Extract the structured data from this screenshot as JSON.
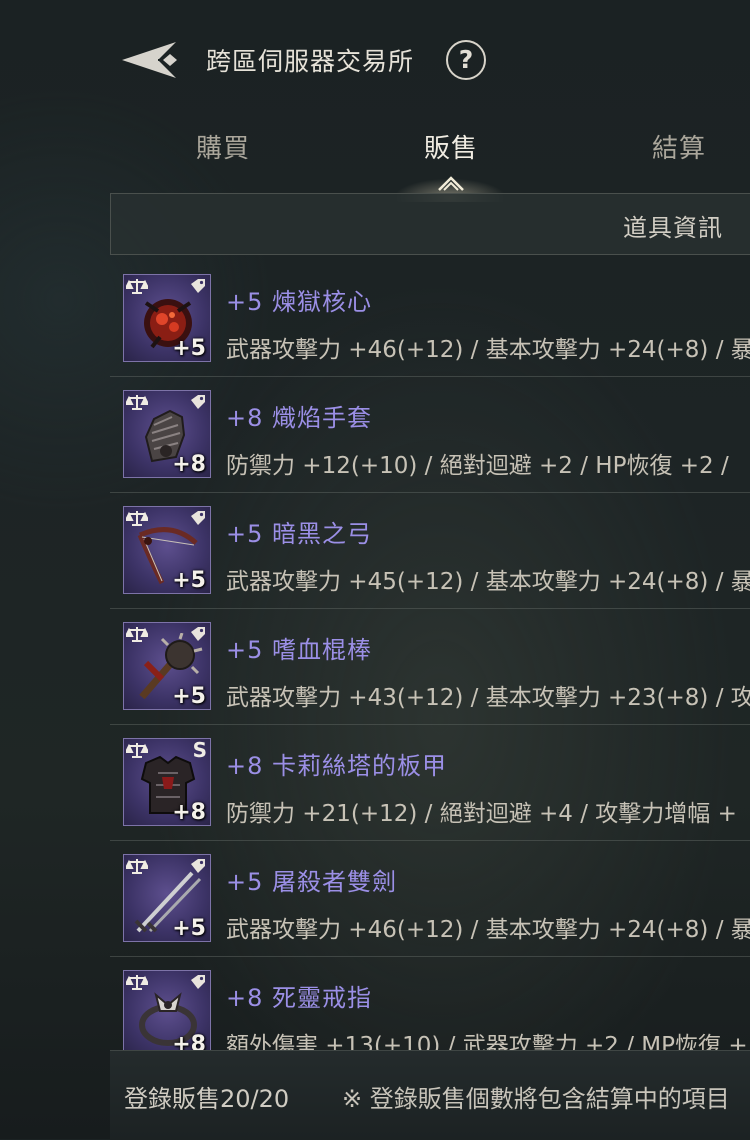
{
  "header": {
    "title": "跨區伺服器交易所",
    "back_icon": "back-arrow-icon",
    "help_label": "?"
  },
  "tabs": [
    {
      "label": "購買",
      "active": false
    },
    {
      "label": "販售",
      "active": true
    },
    {
      "label": "結算",
      "active": false
    }
  ],
  "info_bar": {
    "label": "道具資訊"
  },
  "items": [
    {
      "name": "+5 煉獄核心",
      "level": "+5",
      "stats": "武器攻擊力 +46(+12) / 基本攻擊力 +24(+8) / 暴",
      "icon": "core-icon"
    },
    {
      "name": "+8 熾焰手套",
      "level": "+8",
      "stats": "防禦力 +12(+10) / 絕對迴避 +2 / HP恢復 +2 /",
      "icon": "gauntlet-icon"
    },
    {
      "name": "+5 暗黑之弓",
      "level": "+5",
      "stats": "武器攻擊力 +45(+12) / 基本攻擊力 +24(+8) / 暴",
      "icon": "bow-icon"
    },
    {
      "name": "+5 嗜血棍棒",
      "level": "+5",
      "stats": "武器攻擊力 +43(+12) / 基本攻擊力 +23(+8) / 攻",
      "icon": "club-icon"
    },
    {
      "name": "+8 卡莉絲塔的板甲",
      "level": "+8",
      "stats": "防禦力 +21(+12) / 絕對迴避 +4 / 攻擊力增幅 +",
      "icon": "plate-armor-icon",
      "badge": "S"
    },
    {
      "name": "+5 屠殺者雙劍",
      "level": "+5",
      "stats": "武器攻擊力 +46(+12) / 基本攻擊力 +24(+8) / 暴",
      "icon": "dual-swords-icon"
    },
    {
      "name": "+8 死靈戒指",
      "level": "+8",
      "stats": "額外傷害 +13(+10) / 武器攻擊力 +2 / MP恢復 +",
      "icon": "ring-icon"
    }
  ],
  "footer": {
    "count_label": "登錄販售20/20",
    "note": "※ 登錄販售個數將包含結算中的項目"
  },
  "colors": {
    "item_name": "#9b8fe6",
    "slot_bg": "#3c3366",
    "background": "#1d2425"
  }
}
